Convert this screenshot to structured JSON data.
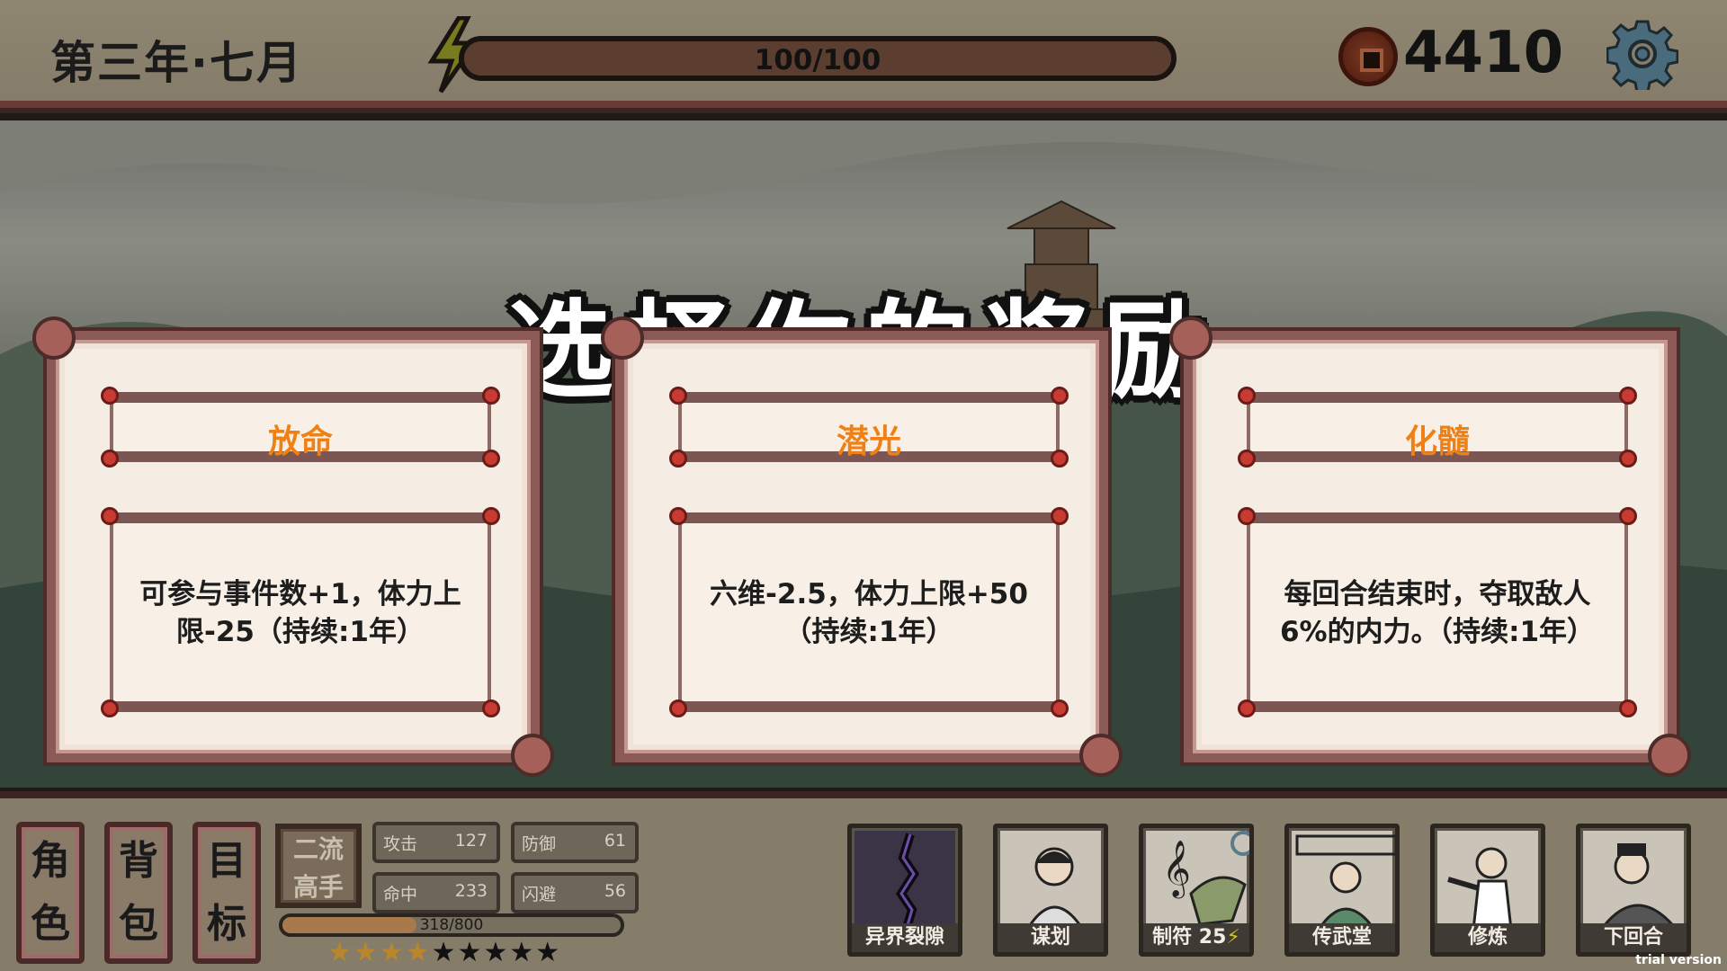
{
  "header": {
    "date": "第三年·七月",
    "energy_text": "100/100",
    "energy_fraction": 1.0,
    "coins": "4410"
  },
  "headline": "选择你的奖励",
  "rewards": [
    {
      "title": "放命",
      "desc": "可参与事件数+1，体力上限-25（持续:1年）"
    },
    {
      "title": "潜光",
      "desc": "六维-2.5，体力上限+50（持续:1年）"
    },
    {
      "title": "化髓",
      "desc": "每回合结束时，夺取敌人6%的内力。（持续:1年）"
    }
  ],
  "side_buttons": [
    {
      "line1": "角",
      "line2": "色"
    },
    {
      "line1": "背",
      "line2": "包"
    },
    {
      "line1": "目",
      "line2": "标"
    }
  ],
  "rank": {
    "line1": "二流",
    "line2": "高手"
  },
  "stats": [
    {
      "label": "攻击",
      "value": "127"
    },
    {
      "label": "防御",
      "value": "61"
    },
    {
      "label": "命中",
      "value": "233"
    },
    {
      "label": "闪避",
      "value": "56"
    }
  ],
  "xp": {
    "text": "318/800",
    "fraction": 0.3975
  },
  "stars": {
    "filled": 4,
    "total": 9
  },
  "actions": [
    {
      "label": "异界裂隙",
      "icon": "rift-icon"
    },
    {
      "label": "谋划",
      "icon": "scheming-woman-icon"
    },
    {
      "label": "制符",
      "cost": "25",
      "icon": "talisman-icon"
    },
    {
      "label": "传武堂",
      "icon": "teaching-hall-icon"
    },
    {
      "label": "修炼",
      "icon": "training-icon"
    },
    {
      "label": "下回合",
      "icon": "sleeping-scholar-icon"
    }
  ],
  "watermark": "trial version",
  "colors": {
    "reward_title": "#f08014",
    "frame": "#8c5a56",
    "accent_knob": "#c83b33"
  }
}
